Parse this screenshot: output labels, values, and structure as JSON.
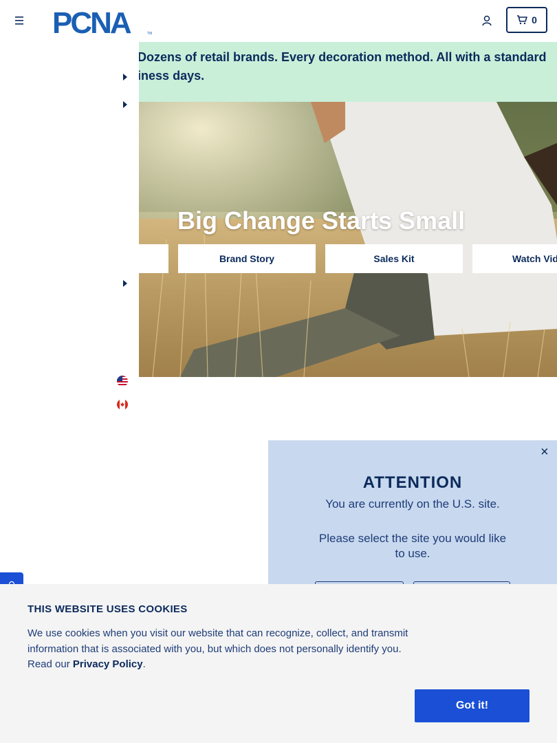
{
  "header": {
    "logo_text": "PCNA",
    "logo_tm": "TM",
    "cart_count": "0"
  },
  "announcement": {
    "line1": "Thousands of products. Dozens of retail brands. Every decoration method. All with a standard lead time of just five business days."
  },
  "hero": {
    "title": "Big Change Starts Small",
    "buttons": [
      "Brand Story",
      "Sales Kit",
      "Watch Video"
    ]
  },
  "modal": {
    "close": "×",
    "title": "ATTENTION",
    "line1": "You are currently on the U.S. site.",
    "line2": "Please select the site you would like to use."
  },
  "cookie": {
    "title": "THIS WEBSITE USES COOKIES",
    "text": "We use cookies when you visit our website that can recognize, collect, and transmit information that is associated with you, but which does not personally identify you. Read our ",
    "link": "Privacy Policy",
    "after": ".",
    "button": "Got it!"
  },
  "colors": {
    "brand_navy": "#0b2a5b",
    "announce_bg": "#c9efd9",
    "modal_bg": "#c8d8ee",
    "cta_blue": "#1a4fd6"
  },
  "icons": [
    "menu-icon",
    "user-icon",
    "cart-icon",
    "caret-right-icon",
    "us-flag-icon",
    "canada-flag-icon",
    "close-icon",
    "feedback-icon"
  ]
}
